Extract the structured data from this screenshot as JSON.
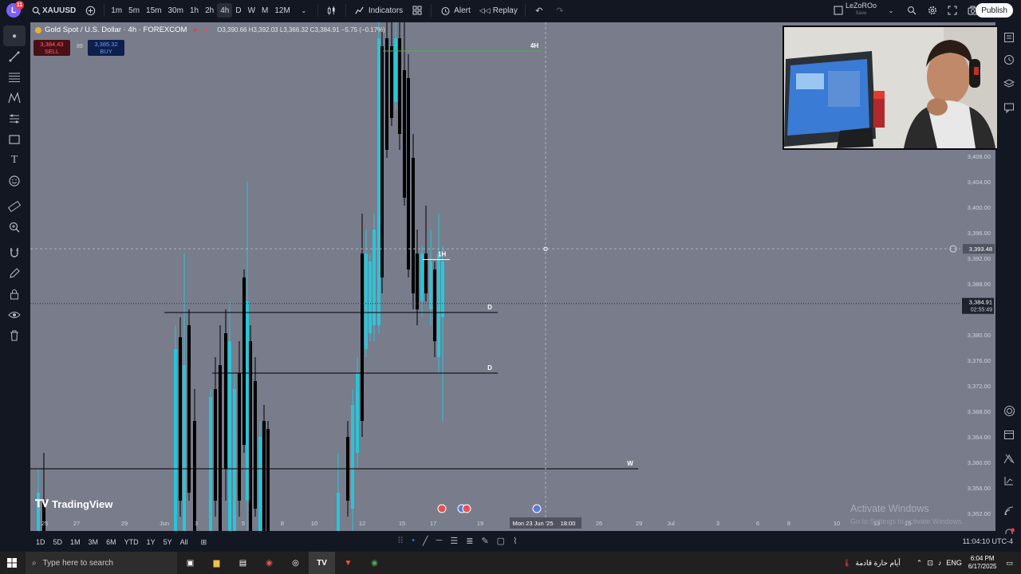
{
  "topbar": {
    "avatar_letter": "L",
    "avatar_badge": "11",
    "symbol": "XAUUSD",
    "timeframes": [
      "1m",
      "5m",
      "15m",
      "30m",
      "1h",
      "2h",
      "4h",
      "D",
      "W",
      "M",
      "12M"
    ],
    "active_timeframe": "4h",
    "indicators_label": "Indicators",
    "alert_label": "Alert",
    "replay_label": "Replay",
    "username": "LeZoROo",
    "user_sub": "Save",
    "publish_label": "Publish"
  },
  "legend": {
    "title": "Gold Spot / U.S. Dollar · 4h · FOREXCOM",
    "ohlc": "O3,390.66 H3,392.03 L3,366.32 C3,384.91 −5.75 (−0.17%)",
    "sell_price": "3,384.43",
    "sell_label": "SELL",
    "spread": "89",
    "buy_price": "3,385.32",
    "buy_label": "BUY"
  },
  "chart_data": {
    "type": "candlestick",
    "price_axis_ticks": [
      "3,408.00",
      "3,404.00",
      "3,400.00",
      "3,396.00",
      "3,392.00",
      "3,388.00",
      "3,384.00",
      "3,380.00",
      "3,376.00",
      "3,372.00",
      "3,368.00",
      "3,364.00",
      "3,360.00",
      "3,356.00",
      "3,352.00"
    ],
    "time_axis_ticks": [
      "25",
      "27",
      "29",
      "Jun",
      "3",
      "5",
      "8",
      "10",
      "12",
      "15",
      "17",
      "19",
      "Mon 23 Jun '25",
      "18:00",
      "26",
      "29",
      "Jul",
      "3",
      "6",
      "8",
      "10",
      "13",
      "15"
    ],
    "crosshair_price": "3,393.48",
    "last_price": "3,384.91",
    "countdown": "02:55:49",
    "levels": [
      {
        "label": "4H",
        "price": 3424.5,
        "color": "#4caf50"
      },
      {
        "label": "1H",
        "price": 3391.8,
        "color": "#ffffff"
      },
      {
        "label": "D",
        "price": 3383.5,
        "color": "#000000"
      },
      {
        "label": "D",
        "price": 3374.0,
        "color": "#000000"
      },
      {
        "label": "W",
        "price": 3359.0,
        "color": "#000000"
      }
    ]
  },
  "watermark": {
    "logo_text": "TradingView",
    "activate_title": "Activate Windows",
    "activate_sub": "Go to Settings to activate Windows."
  },
  "bottombar": {
    "ranges": [
      "1D",
      "5D",
      "1M",
      "3M",
      "6M",
      "YTD",
      "1Y",
      "5Y",
      "All"
    ],
    "clock": "11:04:10 UTC-4"
  },
  "taskbar": {
    "search_placeholder": "Type here to search",
    "weather_text": "أيام حارة قادمة",
    "lang": "ENG",
    "time": "6:04 PM",
    "date": "6/17/2025"
  },
  "colors": {
    "chart_bg": "#787c8b",
    "candle_up": "#26c6da",
    "candle_down": "#000000",
    "level_green": "#4caf50"
  }
}
